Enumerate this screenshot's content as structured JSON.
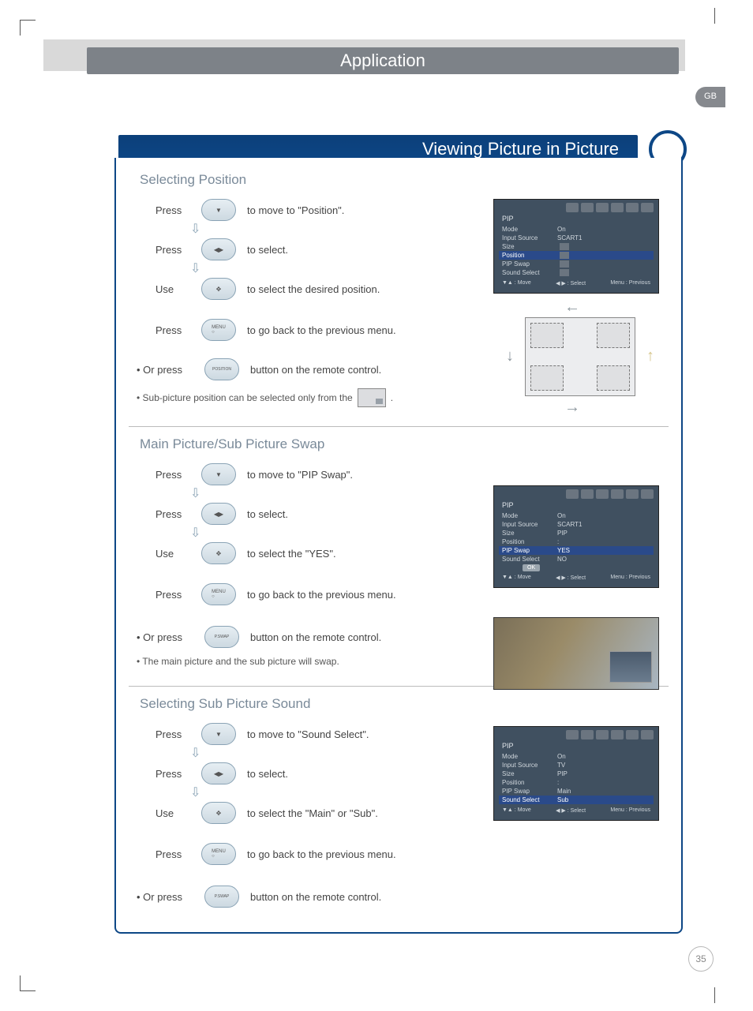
{
  "header": "Application",
  "lang_badge": "GB",
  "title": "Viewing Picture in Picture",
  "page_number": "35",
  "sections": [
    {
      "heading": "Selecting Position",
      "steps": [
        {
          "label": "Press",
          "icon": "nav-down",
          "text": "to move to \"Position\"."
        },
        {
          "label": "Press",
          "icon": "nav-lr",
          "text": "to select."
        },
        {
          "label": "Use",
          "icon": "nav-quad",
          "text": "to select the desired position."
        },
        {
          "label": "Press",
          "icon": "menu",
          "text": "to go back to the previous menu."
        }
      ],
      "remote": {
        "label": "• Or press",
        "icon": "POSITION",
        "text": "button on the remote control."
      },
      "notes": [
        {
          "text_before": "• Sub-picture position can be selected only from the",
          "has_mini_box": true,
          "text_after": "."
        }
      ],
      "osd": {
        "title": "PIP",
        "rows": [
          {
            "k": "Mode",
            "v": "On"
          },
          {
            "k": "Input Source",
            "v": "SCART1"
          },
          {
            "k": "Size",
            "v": ""
          },
          {
            "k": "Position",
            "v": "",
            "highlight": true
          },
          {
            "k": "PIP Swap",
            "v": ":"
          },
          {
            "k": "Sound Select",
            "v": ":"
          }
        ],
        "footer": [
          "▼▲ : Move",
          "◀ ▶ : Select",
          "Menu : Previous"
        ]
      }
    },
    {
      "heading": "Main Picture/Sub Picture Swap",
      "steps": [
        {
          "label": "Press",
          "icon": "nav-down",
          "text": "to move to \"PIP Swap\"."
        },
        {
          "label": "Press",
          "icon": "nav-lr",
          "text": "to select."
        },
        {
          "label": "Use",
          "icon": "nav-quad",
          "text": "to select the \"YES\"."
        },
        {
          "label": "Press",
          "icon": "menu",
          "text": "to go back to the previous menu."
        }
      ],
      "remote": {
        "label": "• Or press",
        "icon": "P.SWAP",
        "text": "button on the remote control."
      },
      "notes": [
        {
          "text_before": "• The main picture and the sub picture will swap."
        }
      ],
      "osd": {
        "title": "PIP",
        "rows": [
          {
            "k": "Mode",
            "v": "On"
          },
          {
            "k": "Input Source",
            "v": "SCART1"
          },
          {
            "k": "Size",
            "v": "PIP"
          },
          {
            "k": "Position",
            "v": ":"
          },
          {
            "k": "PIP Swap",
            "v": "YES",
            "highlight": true
          },
          {
            "k": "Sound Select",
            "v": "NO"
          }
        ],
        "ok_label": "OK",
        "footer": [
          "▼▲ : Move",
          "◀ ▶ : Select",
          "Menu : Previous"
        ]
      }
    },
    {
      "heading": "Selecting Sub Picture Sound",
      "steps": [
        {
          "label": "Press",
          "icon": "nav-down",
          "text": "to move to \"Sound Select\"."
        },
        {
          "label": "Press",
          "icon": "nav-lr",
          "text": "to select."
        },
        {
          "label": "Use",
          "icon": "nav-quad",
          "text": "to select the \"Main\" or \"Sub\"."
        },
        {
          "label": "Press",
          "icon": "menu",
          "text": "to go back to the previous menu."
        }
      ],
      "remote": {
        "label": "• Or press",
        "icon": "P.SWAP",
        "text": "button on the remote control."
      },
      "osd": {
        "title": "PIP",
        "rows": [
          {
            "k": "Mode",
            "v": "On"
          },
          {
            "k": "Input Source",
            "v": "TV"
          },
          {
            "k": "Size",
            "v": "PIP"
          },
          {
            "k": "Position",
            "v": ":"
          },
          {
            "k": "PIP Swap",
            "v": "Main"
          },
          {
            "k": "Sound Select",
            "v": "Sub",
            "highlight": true
          }
        ],
        "footer": [
          "▼▲ : Move",
          "◀ ▶ : Select",
          "Menu : Previous"
        ]
      }
    }
  ]
}
